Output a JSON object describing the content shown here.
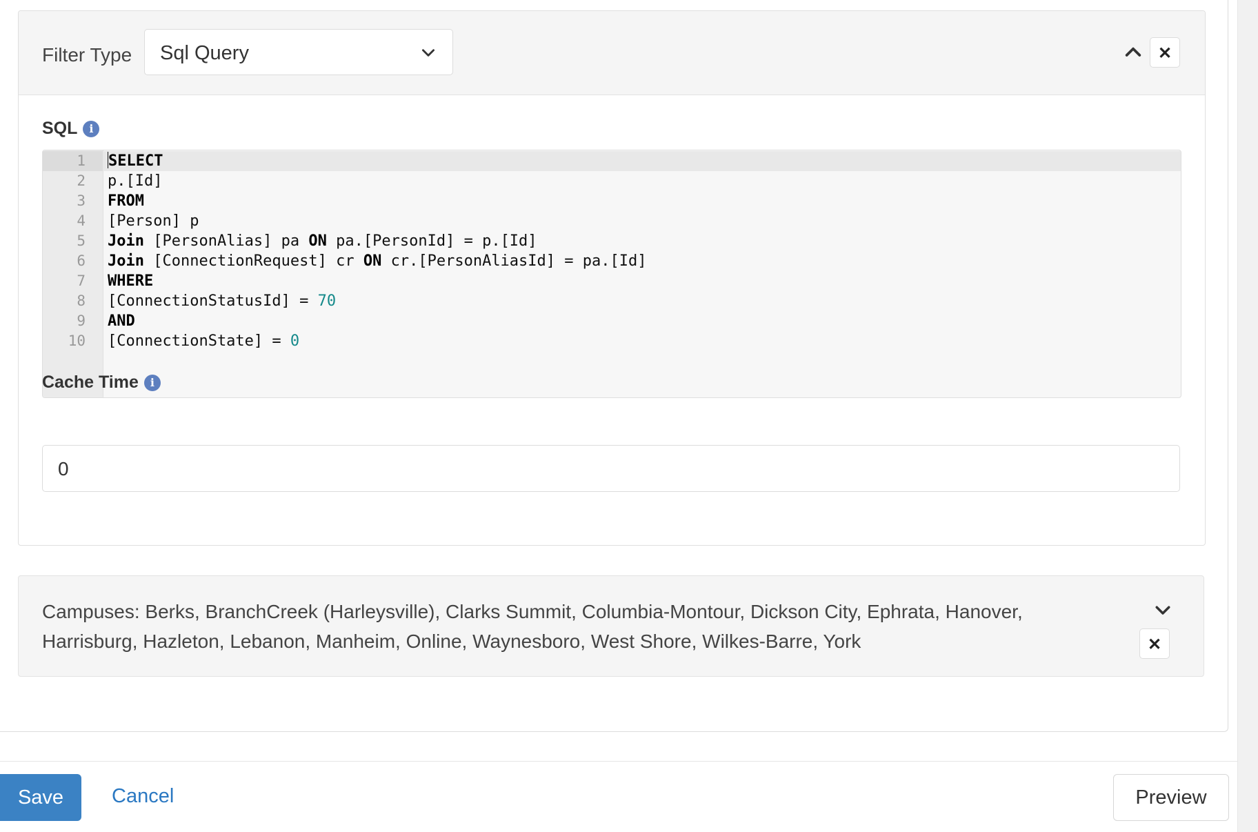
{
  "filter": {
    "type_label": "Filter Type",
    "type_value": "Sql Query",
    "close_glyph": "✕"
  },
  "sql": {
    "label": "SQL",
    "info_glyph": "i",
    "lines": [
      {
        "n": "1",
        "parts": [
          {
            "t": "SELECT",
            "c": "kw"
          }
        ]
      },
      {
        "n": "2",
        "parts": [
          {
            "t": "p.[Id]",
            "c": ""
          }
        ]
      },
      {
        "n": "3",
        "parts": [
          {
            "t": "FROM",
            "c": "kw"
          }
        ]
      },
      {
        "n": "4",
        "parts": [
          {
            "t": "[Person] p",
            "c": ""
          }
        ]
      },
      {
        "n": "5",
        "parts": [
          {
            "t": "Join",
            "c": "kw"
          },
          {
            "t": " [PersonAlias] pa ",
            "c": ""
          },
          {
            "t": "ON",
            "c": "kw"
          },
          {
            "t": " pa.[PersonId] = p.[Id]",
            "c": ""
          }
        ]
      },
      {
        "n": "6",
        "parts": [
          {
            "t": "Join",
            "c": "kw"
          },
          {
            "t": " [ConnectionRequest] cr ",
            "c": ""
          },
          {
            "t": "ON",
            "c": "kw"
          },
          {
            "t": " cr.[PersonAliasId] = pa.[Id]",
            "c": ""
          }
        ]
      },
      {
        "n": "7",
        "parts": [
          {
            "t": "WHERE",
            "c": "kw"
          }
        ]
      },
      {
        "n": "8",
        "parts": [
          {
            "t": "[ConnectionStatusId] = ",
            "c": ""
          },
          {
            "t": "70",
            "c": "num"
          }
        ]
      },
      {
        "n": "9",
        "parts": [
          {
            "t": "AND",
            "c": "kw"
          }
        ]
      },
      {
        "n": "10",
        "parts": [
          {
            "t": "[ConnectionState] = ",
            "c": ""
          },
          {
            "t": "0",
            "c": "num"
          }
        ]
      }
    ]
  },
  "cache": {
    "label": "Cache Time",
    "info_glyph": "i",
    "value": "0"
  },
  "campuses": {
    "text": "Campuses: Berks, BranchCreek (Harleysville), Clarks Summit, Columbia-Montour, Dickson City, Ephrata, Hanover, Harrisburg, Hazleton, Lebanon, Manheim, Online, Waynesboro, West Shore, Wilkes-Barre, York",
    "close_glyph": "✕"
  },
  "footer": {
    "save_label": "Save",
    "cancel_label": "Cancel",
    "preview_label": "Preview"
  },
  "colors": {
    "primary": "#3b82c4",
    "link": "#2a78c2",
    "info": "#5d7fbf",
    "number": "#14898a"
  },
  "icons": {
    "type_dropdown": "chevron-down-icon",
    "collapse": "chevron-up-icon",
    "close": "close-icon",
    "info": "info-icon",
    "expand": "chevron-down-icon"
  }
}
